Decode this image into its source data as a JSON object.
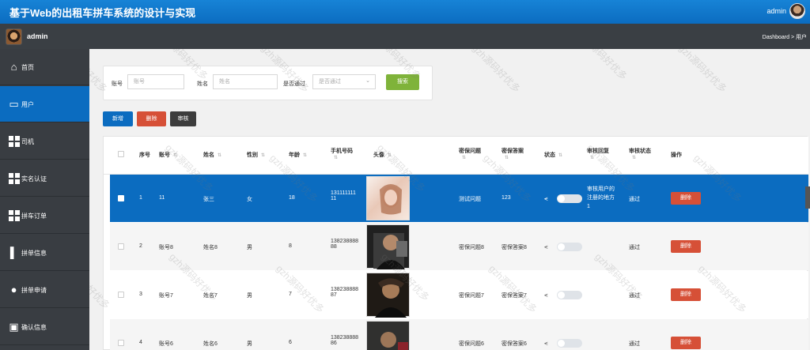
{
  "topbar": {
    "title": "基于Web的出租车拼车系统的设计与实现",
    "user": "admin"
  },
  "subbar": {
    "user": "admin",
    "breadcrumb": "Dashboard > 用户"
  },
  "sidebar": {
    "items": [
      {
        "label": "首页",
        "icon": "home-icon"
      },
      {
        "label": "用户",
        "icon": "chat-icon"
      },
      {
        "label": "司机",
        "icon": "grid-icon"
      },
      {
        "label": "实名认证",
        "icon": "grid-icon"
      },
      {
        "label": "拼车订单",
        "icon": "grid-icon"
      },
      {
        "label": "拼单信息",
        "icon": "book-icon"
      },
      {
        "label": "拼单申请",
        "icon": "bulb-icon"
      },
      {
        "label": "确认信息",
        "icon": "wallet-icon"
      }
    ]
  },
  "search": {
    "account_label": "账号",
    "account_placeholder": "账号",
    "name_label": "姓名",
    "name_placeholder": "姓名",
    "approved_label": "是否通过",
    "approved_value": "是否通过",
    "button": "搜索"
  },
  "actions": {
    "add": "新增",
    "delete": "删除",
    "review": "审核"
  },
  "table": {
    "headers": [
      "序号",
      "账号",
      "姓名",
      "性别",
      "年龄",
      "手机号码",
      "头像",
      "密保问题",
      "密保答案",
      "状态",
      "审核回复",
      "审核状态",
      "操作"
    ],
    "rows": [
      {
        "index": "1",
        "account": "11",
        "name": "张三",
        "gender": "女",
        "age": "18",
        "phone1": "131111111",
        "phone2": "11",
        "question": "测试问题",
        "answer": "123",
        "reply1": "审核用户的",
        "reply2": "注册的地方",
        "reply3": "1",
        "status": "通过",
        "delete": "删除"
      },
      {
        "index": "2",
        "account": "账号8",
        "name": "姓名8",
        "gender": "男",
        "age": "8",
        "phone1": "138238888",
        "phone2": "88",
        "question": "密保问题8",
        "answer": "密保答案8",
        "reply1": "",
        "reply2": "",
        "reply3": "",
        "status": "通过",
        "delete": "删除"
      },
      {
        "index": "3",
        "account": "账号7",
        "name": "姓名7",
        "gender": "男",
        "age": "7",
        "phone1": "138238888",
        "phone2": "87",
        "question": "密保问题7",
        "answer": "密保答案7",
        "reply1": "",
        "reply2": "",
        "reply3": "",
        "status": "通过",
        "delete": "删除"
      },
      {
        "index": "4",
        "account": "账号6",
        "name": "姓名6",
        "gender": "男",
        "age": "6",
        "phone1": "138238888",
        "phone2": "86",
        "question": "密保问题6",
        "answer": "密保答案6",
        "reply1": "",
        "reply2": "",
        "reply3": "",
        "status": "通过",
        "delete": "删除"
      }
    ]
  },
  "watermark": "gzh源码好优多",
  "colors": {
    "primary": "#0b6cc0",
    "sidebar": "#393d42",
    "search": "#7fb33a",
    "danger": "#d65037",
    "review": "#3d3d3d"
  }
}
